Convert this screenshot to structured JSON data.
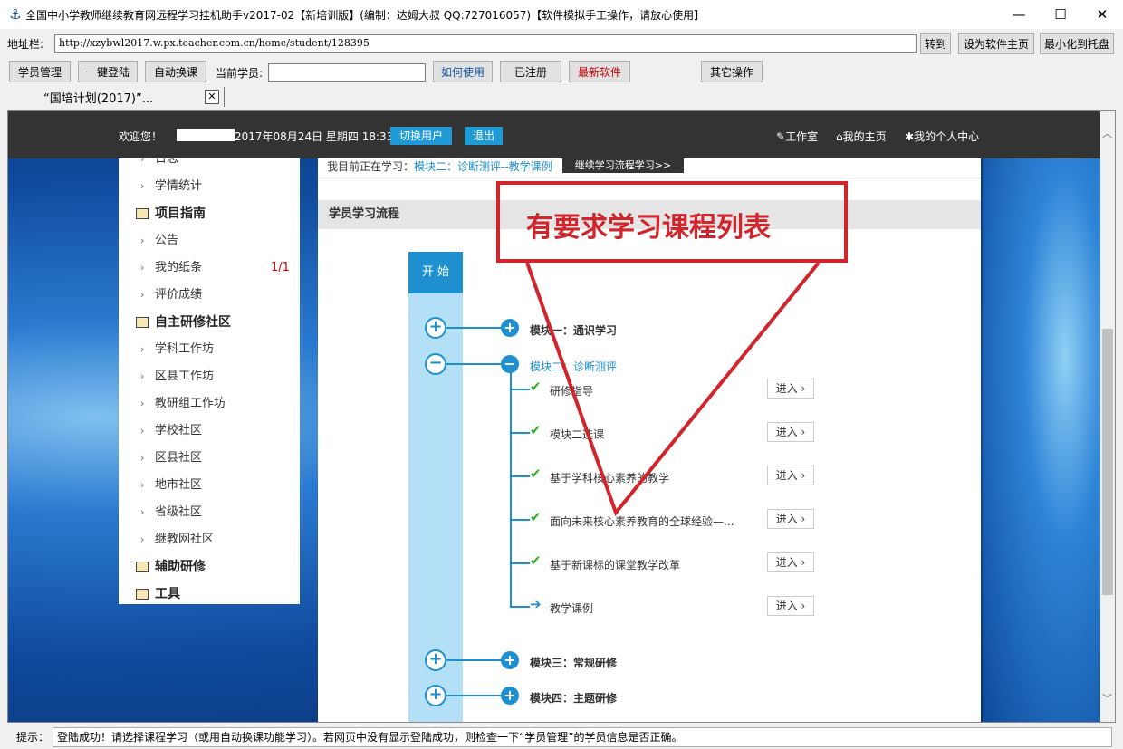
{
  "window": {
    "title": "全国中小学教师继续教育网远程学习挂机助手v2017-02【新培训版】(编制：达姆大叔 QQ:727016057)【软件模拟手工操作，请放心使用】",
    "minimize": "—",
    "maximize": "☐",
    "close": "✕"
  },
  "address": {
    "label": "地址栏:",
    "url": "http://xzybwl2017.w.px.teacher.com.cn/home/student/128395",
    "go": "转到",
    "set_home": "设为软件主页",
    "minimize_tray": "最小化到托盘"
  },
  "toolbar": {
    "student_mgmt": "学员管理",
    "one_click_login": "一键登陆",
    "auto_switch": "自动换课",
    "current_student_label": "当前学员:",
    "how_to_use": "如何使用",
    "registered": "已注册",
    "latest": "最新软件",
    "other": "其它操作"
  },
  "tab": {
    "label": "“国培计划(2017)”...",
    "close": "✕"
  },
  "page": {
    "welcome": "欢迎您！",
    "datetime": "2017年08月24日 星期四 18:33",
    "switch_user": "切换用户",
    "logout": "退出",
    "nav": [
      "工作室",
      "我的主页",
      "我的个人中心"
    ]
  },
  "sidebar": {
    "items": [
      {
        "label": "日志",
        "type": "item"
      },
      {
        "label": "学情统计",
        "type": "item"
      },
      {
        "label": "项目指南",
        "type": "head"
      },
      {
        "label": "公告",
        "type": "item"
      },
      {
        "label": "我的纸条",
        "type": "item",
        "count": "1/1"
      },
      {
        "label": "评价成绩",
        "type": "item"
      },
      {
        "label": "自主研修社区",
        "type": "head"
      },
      {
        "label": "学科工作坊",
        "type": "item"
      },
      {
        "label": "区县工作坊",
        "type": "item"
      },
      {
        "label": "教研组工作坊",
        "type": "item"
      },
      {
        "label": "学校社区",
        "type": "item"
      },
      {
        "label": "区县社区",
        "type": "item"
      },
      {
        "label": "地市社区",
        "type": "item"
      },
      {
        "label": "省级社区",
        "type": "item"
      },
      {
        "label": "继教网社区",
        "type": "item"
      },
      {
        "label": "辅助研修",
        "type": "head"
      },
      {
        "label": "工具",
        "type": "head"
      }
    ]
  },
  "main": {
    "studying_label": "我目前正在学习：",
    "studying_value": "模块二：诊断测评--教学课例",
    "continue": "继续学习流程学习>>",
    "flow_title": "学员学习流程",
    "start": "开 始",
    "modules": [
      "模块一：通识学习",
      "模块二：诊断测评",
      "模块三：常规研修",
      "模块四：主题研修"
    ],
    "items": [
      "研修指导",
      "模块二选课",
      "基于学科核心素养的教学",
      "面向未来核心素养教育的全球经验—...",
      "基于新课标的课堂教学改革",
      "教学课例"
    ],
    "enter": "进入 ›"
  },
  "annotation": {
    "text": "有要求学习课程列表"
  },
  "status": {
    "label": "提示：",
    "message": "登陆成功！请选择课程学习（或用自动换课功能学习）。若网页中没有显示登陆成功，则检查一下“学员管理”的学员信息是否正确。"
  },
  "colors": {
    "accent": "#1e8fd0",
    "annotation": "#d1242b",
    "check": "#2ab22a",
    "topbar": "#333333"
  }
}
